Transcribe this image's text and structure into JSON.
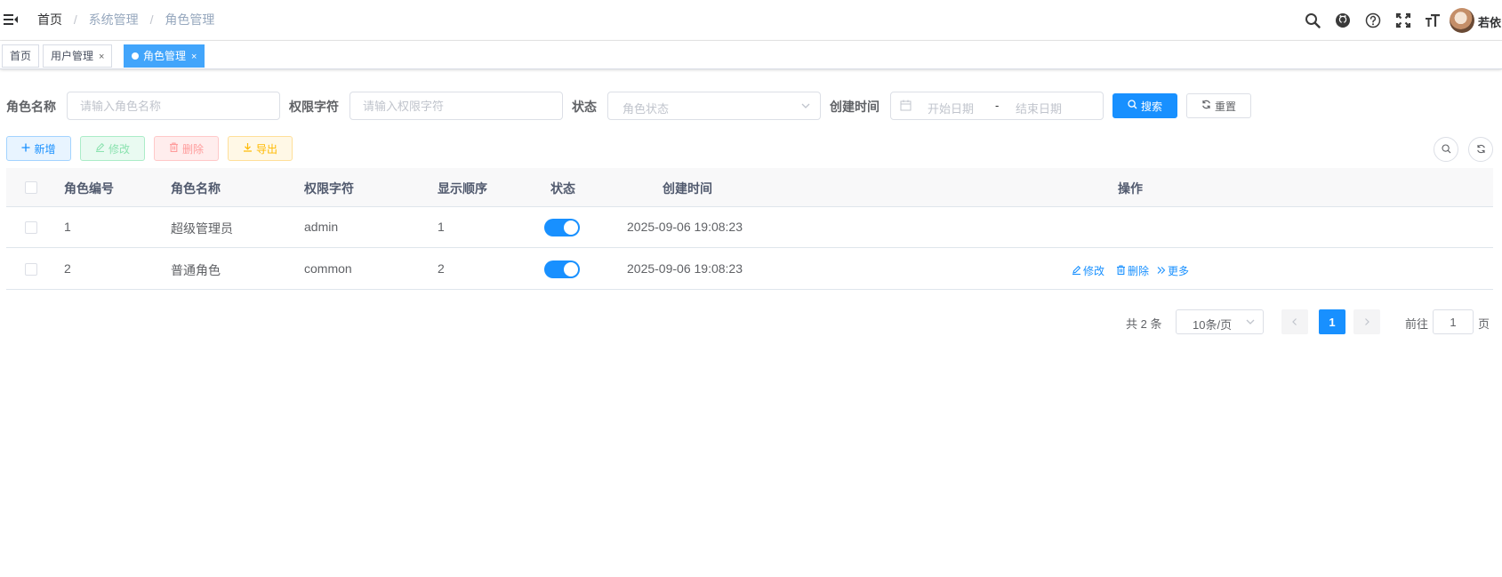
{
  "breadcrumb": {
    "home": "首页",
    "sep": "/",
    "level1": "系统管理",
    "level2": "角色管理"
  },
  "user": {
    "name": "若依"
  },
  "tags": [
    {
      "label": "首页",
      "closable": false,
      "active": false
    },
    {
      "label": "用户管理",
      "close": "×",
      "active": false
    },
    {
      "label": "角色管理",
      "close": "×",
      "active": true
    }
  ],
  "search": {
    "role_name_label": "角色名称",
    "role_name_placeholder": "请输入角色名称",
    "role_key_label": "权限字符",
    "role_key_placeholder": "请输入权限字符",
    "status_label": "状态",
    "status_placeholder": "角色状态",
    "created_label": "创建时间",
    "start_placeholder": "开始日期",
    "range_sep": "-",
    "end_placeholder": "结束日期",
    "search_btn": "搜索",
    "reset_btn": "重置"
  },
  "toolbar": {
    "add": "新增",
    "edit": "修改",
    "delete": "删除",
    "export": "导出"
  },
  "table": {
    "headers": [
      "角色编号",
      "角色名称",
      "权限字符",
      "显示顺序",
      "状态",
      "创建时间",
      "操作"
    ],
    "rows": [
      {
        "id": "1",
        "name": "超级管理员",
        "key": "admin",
        "sort": "1",
        "status_on": true,
        "created": "2025-09-06 19:08:23",
        "actions": []
      },
      {
        "id": "2",
        "name": "普通角色",
        "key": "common",
        "sort": "2",
        "status_on": true,
        "created": "2025-09-06 19:08:23",
        "actions": [
          "修改",
          "删除",
          "更多"
        ]
      }
    ]
  },
  "pagination": {
    "total_text": "共 2 条",
    "page_size": "10条/页",
    "current_page": "1",
    "goto_label": "前往",
    "goto_value": "1",
    "page_suffix": "页"
  },
  "colors": {
    "primary": "#1890ff",
    "tag_active": "#42a5fb",
    "header_bg": "#f8f8f9"
  }
}
